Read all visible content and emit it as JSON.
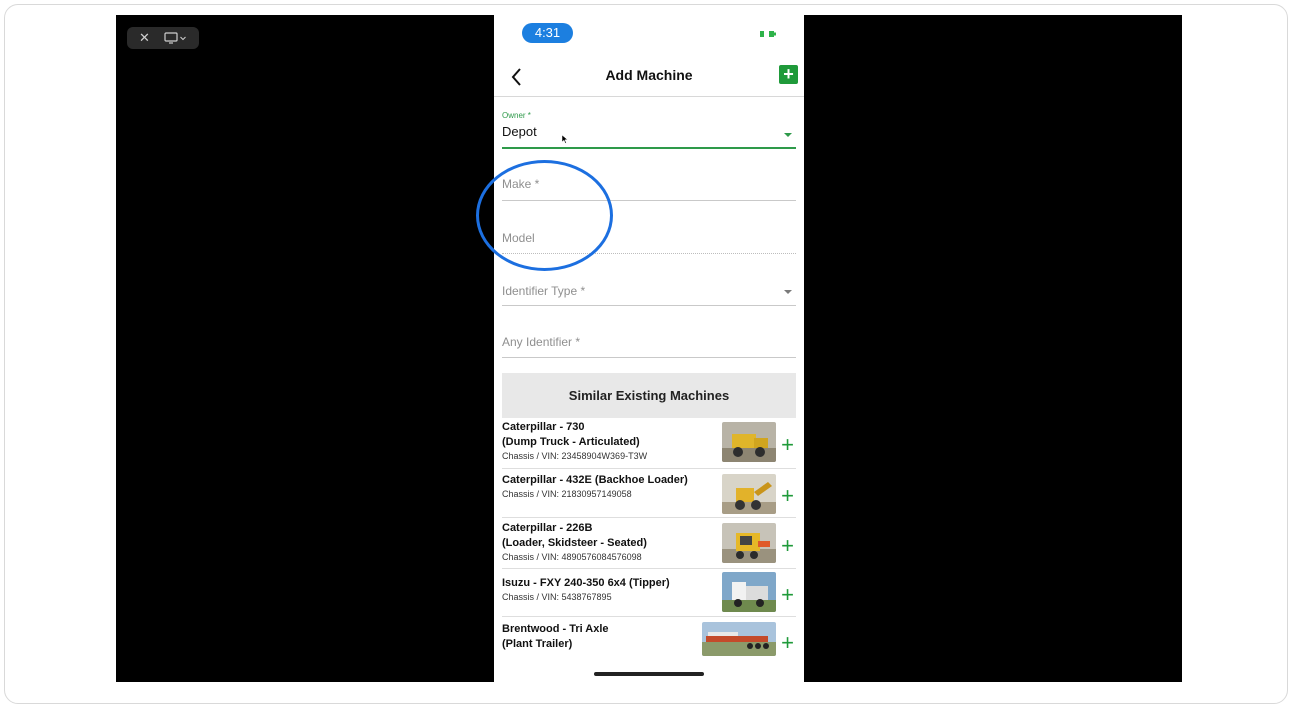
{
  "status_bar": {
    "time": "4:31"
  },
  "nav": {
    "title": "Add Machine",
    "add_symbol": "+"
  },
  "form": {
    "owner": {
      "label": "Owner *",
      "value": "Depot"
    },
    "make": {
      "placeholder": "Make *"
    },
    "model": {
      "placeholder": "Model"
    },
    "identifier_type": {
      "placeholder": "Identifier Type *"
    },
    "any_identifier": {
      "placeholder": "Any Identifier *"
    }
  },
  "similar": {
    "header": "Similar Existing Machines",
    "items": [
      {
        "name": "Caterpillar - 730",
        "subtitle": "(Dump Truck - Articulated)",
        "vin": "Chassis / VIN: 23458904W369-T3W"
      },
      {
        "name": "Caterpillar - 432E (Backhoe Loader)",
        "subtitle": "",
        "vin": "Chassis / VIN: 21830957149058"
      },
      {
        "name": "Caterpillar - 226B",
        "subtitle": "(Loader, Skidsteer - Seated)",
        "vin": "Chassis / VIN: 4890576084576098"
      },
      {
        "name": "Isuzu - FXY 240-350 6x4 (Tipper)",
        "subtitle": "",
        "vin": "Chassis / VIN: 5438767895"
      },
      {
        "name": "Brentwood - Tri Axle",
        "subtitle": "(Plant Trailer)",
        "vin": ""
      }
    ],
    "add_symbol": "+"
  },
  "viewer_controls": {
    "close_symbol": "✕"
  },
  "colors": {
    "accent_green": "#1f9a3a",
    "highlight_blue": "#1c6fe0",
    "status_time_blue": "#1c7fe0"
  },
  "icons": [
    "close-icon",
    "screen-share-icon",
    "chevron-down-icon",
    "back-chevron-icon",
    "plus-icon",
    "battery-icon",
    "dropdown-caret-icon"
  ]
}
